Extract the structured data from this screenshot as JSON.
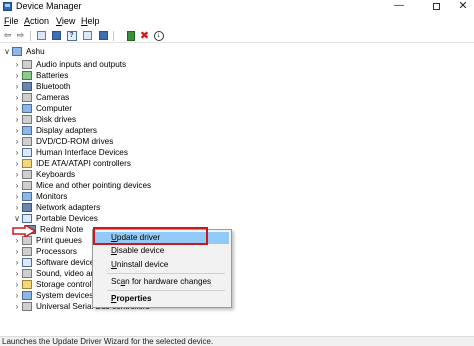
{
  "window": {
    "title": "Device Manager",
    "minimize": "—",
    "close": "✕"
  },
  "menu": [
    {
      "label": "File",
      "key": "F",
      "rest": "ile"
    },
    {
      "label": "Action",
      "key": "A",
      "rest": "ction"
    },
    {
      "label": "View",
      "key": "V",
      "rest": "iew"
    },
    {
      "label": "Help",
      "key": "H",
      "rest": "elp"
    }
  ],
  "toolbar": {
    "back": "⇦",
    "forward": "⇨",
    "help": "?",
    "remove": "✖",
    "icons": [
      "back-icon",
      "forward-icon",
      "properties-icon",
      "list-icon",
      "help-icon",
      "view-icon",
      "update-driver-icon",
      "uninstall-icon",
      "download-icon"
    ]
  },
  "tree": {
    "root": "Ashu",
    "categories": [
      "Audio inputs and outputs",
      "Batteries",
      "Bluetooth",
      "Cameras",
      "Computer",
      "Disk drives",
      "Display adapters",
      "DVD/CD-ROM drives",
      "Human Interface Devices",
      "IDE ATA/ATAPI controllers",
      "Keyboards",
      "Mice and other pointing devices",
      "Monitors",
      "Network adapters",
      "Portable Devices",
      "Redmi Note",
      "Print queues",
      "Processors",
      "Software devices",
      "Sound, video and game controllers",
      "Storage controllers",
      "System devices",
      "Universal Serial Bus controllers"
    ],
    "expanded_marker": "∨",
    "collapsed_marker": "›"
  },
  "context_menu": {
    "items": [
      {
        "label": "Update driver",
        "key": "U",
        "rest": "pdate driver"
      },
      {
        "label": "Disable device",
        "key": "D",
        "rest": "isable device"
      },
      {
        "label": "Uninstall device",
        "key": "U",
        "rest": "ninstall device"
      },
      {
        "label": "Scan for hardware changes",
        "key": "a",
        "pre": "Sc",
        "rest": "n for hardware changes"
      },
      {
        "label": "Properties",
        "key": "P",
        "rest": "roperties"
      }
    ],
    "highlighted": "Update driver"
  },
  "status": {
    "text": "Launches the Update Driver Wizard for the selected device."
  },
  "colors": {
    "highlight": "#91c9f7",
    "annotation_red": "#d0161d"
  }
}
